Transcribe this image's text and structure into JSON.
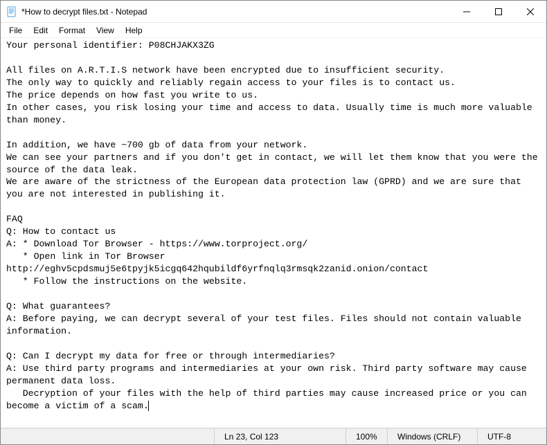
{
  "titlebar": {
    "title": "*How to decrypt files.txt - Notepad"
  },
  "menu": {
    "file": "File",
    "edit": "Edit",
    "format": "Format",
    "view": "View",
    "help": "Help"
  },
  "document": {
    "text": "Your personal identifier: P08CHJAKX3ZG\n\nAll files on A.R.T.I.S network have been encrypted due to insufficient security.\nThe only way to quickly and reliably regain access to your files is to contact us.\nThe price depends on how fast you write to us.\nIn other cases, you risk losing your time and access to data. Usually time is much more valuable than money.\n\nIn addition, we have ~700 gb of data from your network.\nWe can see your partners and if you don't get in contact, we will let them know that you were the source of the data leak.\nWe are aware of the strictness of the European data protection law (GPRD) and we are sure that you are not interested in publishing it.\n\nFAQ\nQ: How to contact us\nA: * Download Tor Browser - https://www.torproject.org/\n   * Open link in Tor Browser\nhttp://eghv5cpdsmuj5e6tpyjk5icgq642hqubildf6yrfnqlq3rmsqk2zanid.onion/contact\n   * Follow the instructions on the website.\n\nQ: What guarantees?\nA: Before paying, we can decrypt several of your test files. Files should not contain valuable information.\n\nQ: Can I decrypt my data for free or through intermediaries?\nA: Use third party programs and intermediaries at your own risk. Third party software may cause permanent data loss.\n   Decryption of your files with the help of third parties may cause increased price or you can become a victim of a scam."
  },
  "statusbar": {
    "position": "Ln 23, Col 123",
    "zoom": "100%",
    "eol": "Windows (CRLF)",
    "encoding": "UTF-8"
  }
}
